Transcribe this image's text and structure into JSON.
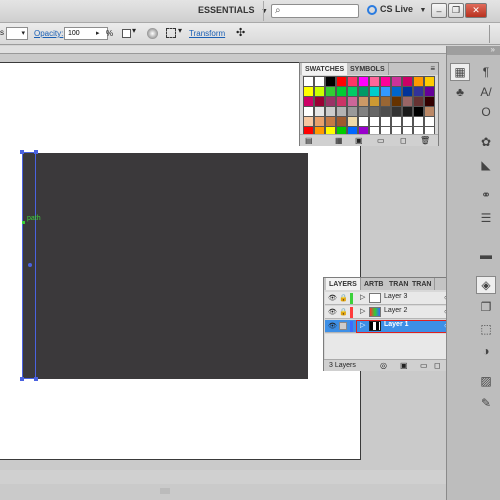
{
  "appbar": {
    "workspace": "ESSENTIALS",
    "workspace_caret": "▼",
    "search_placeholder": "",
    "cs_live": "CS Live",
    "cs_live_caret": "▼",
    "minimize": "–",
    "restore": "❐",
    "close": "✕"
  },
  "control_bar": {
    "left_partial": "s",
    "opacity_label": "Opacity:",
    "opacity_value": "100",
    "opacity_caret": "▸",
    "percent": "%",
    "transform_label": "Transform"
  },
  "canvas": {
    "path_label": "path"
  },
  "swatches_panel": {
    "tabs": [
      "SWATCHES",
      "SYMBOLS"
    ],
    "rows": [
      [
        "#ffffff",
        "#ffffff",
        "#000000",
        "#ff0000",
        "#ff3366",
        "#ff00ff",
        "#ff6699",
        "#ff0099",
        "#cc3399",
        "#cc0066",
        "#ff9900",
        "#ffcc00"
      ],
      [
        "#ffff00",
        "#ccff00",
        "#33cc33",
        "#00cc33",
        "#00cc66",
        "#009966",
        "#00cccc",
        "#3399ff",
        "#0066cc",
        "#003399",
        "#333399",
        "#660099"
      ],
      [
        "#cc0066",
        "#990033",
        "#993366",
        "#cc3366",
        "#cc6699",
        "#cc9966",
        "#cc9933",
        "#996633",
        "#663300",
        "#996666",
        "#663333",
        "#330000"
      ],
      [
        "#ffffff",
        "#e6e6e6",
        "#cccccc",
        "#b3b3b3",
        "#999999",
        "#808080",
        "#666666",
        "#4d4d4d",
        "#333333",
        "#1a1a1a",
        "#000000",
        "#bb8866"
      ],
      [
        "#f5c6a0",
        "#e8a16b",
        "#c47a44",
        "#9e5a2e",
        "#f0d9a8",
        "#ffffff",
        "#ffffff",
        "#ffffff",
        "#ffffff",
        "#ffffff",
        "#ffffff",
        "#ffffff"
      ],
      [
        "#ff0000",
        "#ff9900",
        "#ffff00",
        "#00cc00",
        "#0066ff",
        "#9900cc",
        "#ffffff",
        "#ffffff",
        "#ffffff",
        "#ffffff",
        "#ffffff",
        "#ffffff"
      ]
    ]
  },
  "layers_panel": {
    "tabs": [
      "LAYERS",
      "ARTB",
      "TRAN",
      "TRAN"
    ],
    "layers": [
      {
        "name": "Layer 3",
        "color": "#3bd13b",
        "selected": false
      },
      {
        "name": "Layer 2",
        "color": "#ff3b3b",
        "selected": false
      },
      {
        "name": "Layer 1",
        "color": "#3b6cff",
        "selected": true
      }
    ],
    "footer_count": "3 Layers"
  },
  "right_toolbar": {
    "icons": [
      "paragraph-icon",
      "character-icon",
      "color-guide-icon",
      "gradient-icon",
      "stroke-icon",
      "symbols-icon",
      "align-icon",
      "layers-icon",
      "artboards-icon",
      "transform-icon",
      "appearance-icon",
      "graphic-styles-icon",
      "brush-icon"
    ]
  }
}
